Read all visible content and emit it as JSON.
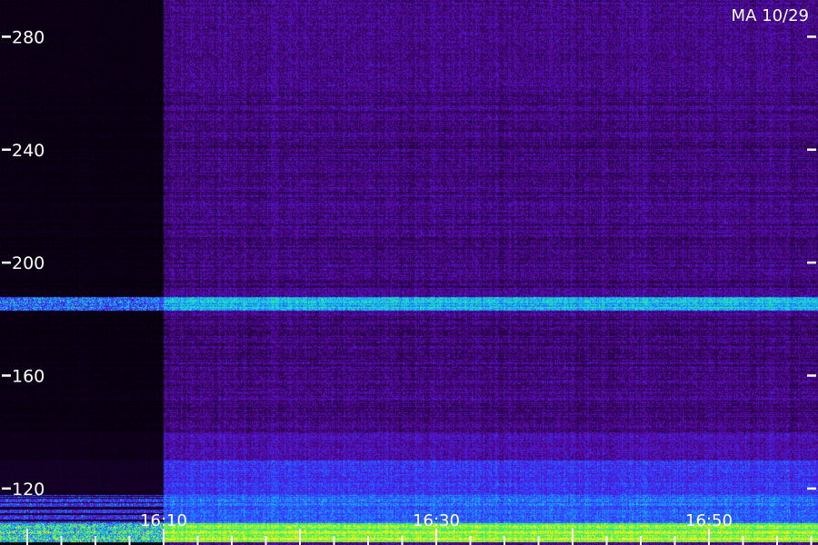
{
  "chart_data": {
    "type": "heatmap",
    "title": "MA 10/29",
    "y_ticks": [
      120,
      160,
      200,
      240,
      280
    ],
    "ylim": [
      100,
      293
    ],
    "x_tick_labels": [
      "16:10",
      "16:30",
      "16:50"
    ],
    "x_tick_minutes": [
      10,
      30,
      50
    ],
    "xlim_minutes": [
      -2,
      58
    ],
    "data_start_minutes": 10,
    "bands": [
      {
        "y_from": 101,
        "y_to": 108,
        "level": 0.95
      },
      {
        "y_from": 108,
        "y_to": 118,
        "level": 0.55
      },
      {
        "y_from": 118,
        "y_to": 130,
        "level": 0.45
      },
      {
        "y_from": 130,
        "y_to": 140,
        "level": 0.32
      },
      {
        "y_from": 183,
        "y_to": 188,
        "level": 0.7
      },
      {
        "y_from": 262,
        "y_to": 290,
        "level": 0.25
      }
    ],
    "colormap": [
      "#000000",
      "#2a0050",
      "#5a0aa0",
      "#3a2cff",
      "#1f7cff",
      "#19e0e0",
      "#3cf04a",
      "#f0f020"
    ],
    "axis_color": "#ffffff"
  }
}
